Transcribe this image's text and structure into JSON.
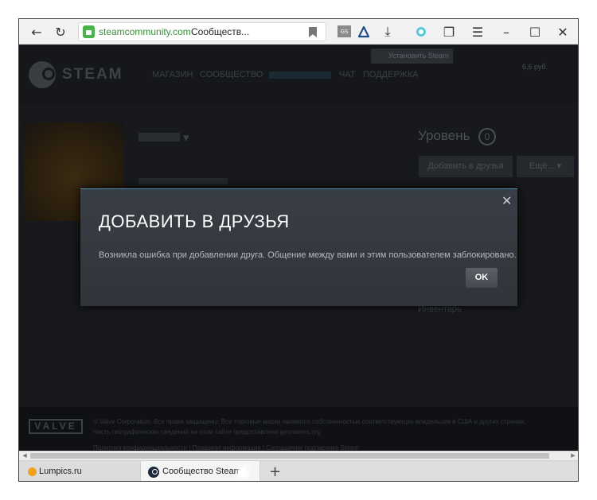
{
  "browser": {
    "address_domain": "steamcommunity.com",
    "address_title": "Сообществ...",
    "toolbar_icons": [
      "back-arrow-icon",
      "reload-icon",
      "lock-icon",
      "bookmark-icon",
      "extension-icon",
      "alice-icon",
      "download-icon",
      "protect-icon",
      "bookmarks-icon",
      "menu-icon",
      "minimize-icon",
      "maximize-icon",
      "close-icon"
    ]
  },
  "steam": {
    "wordmark": "STEAM",
    "nav": [
      "МАГАЗИН",
      "СООБЩЕСТВО",
      "ЧАТ",
      "ПОДДЕРЖКА"
    ],
    "install_label": "Установить Steam",
    "wallet": "6,6 руб.",
    "level_label": "Уровень",
    "level_value": "0",
    "add_friend_label": "Добавить в друзья",
    "more_label": "Ещё...",
    "inventory_label": "Инвентарь",
    "footer_copy_line1": "© Valve Corporation. Все права защищены. Все торговые марки являются собственностью соответствующих владельцев в США и других странах.",
    "footer_copy_line2": "Часть географических сведений на этом сайте предоставлена geonames.org",
    "footer_links": "Политика конфиденциальности  |  Правовая информация  |  Соглашение подписчика Steam",
    "valve_logo": "VALVE"
  },
  "modal": {
    "title": "ДОБАВИТЬ В ДРУЗЬЯ",
    "message": "Возникла ошибка при добавлении друга. Общение между вами и этим пользователем заблокировано.",
    "ok_label": "OK",
    "close_glyph": "✕"
  },
  "tabs": [
    {
      "label": "Lumpics.ru"
    },
    {
      "label": "Сообщество Steam ::"
    }
  ],
  "colors": {
    "modal_accent": "#4f8dad",
    "secure_green": "#4bb34b"
  }
}
